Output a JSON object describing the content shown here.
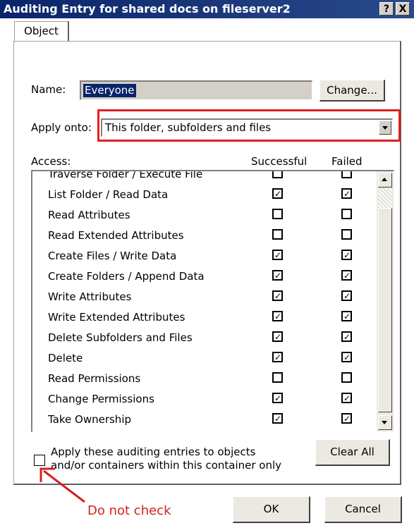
{
  "window": {
    "title": "Auditing Entry for shared docs on fileserver2",
    "help_label": "?",
    "close_label": "X"
  },
  "tab": {
    "label": "Object"
  },
  "name": {
    "label": "Name:",
    "value": "Everyone",
    "change_label": "Change..."
  },
  "apply_onto": {
    "label": "Apply onto:",
    "value": "This folder, subfolders and files"
  },
  "access": {
    "label": "Access:",
    "col_successful": "Successful",
    "col_failed": "Failed",
    "rows": [
      {
        "label": "Traverse Folder / Execute File",
        "successful": false,
        "failed": false
      },
      {
        "label": "List Folder / Read Data",
        "successful": true,
        "failed": true
      },
      {
        "label": "Read Attributes",
        "successful": false,
        "failed": false
      },
      {
        "label": "Read Extended Attributes",
        "successful": false,
        "failed": false
      },
      {
        "label": "Create Files / Write Data",
        "successful": true,
        "failed": true
      },
      {
        "label": "Create Folders / Append Data",
        "successful": true,
        "failed": true
      },
      {
        "label": "Write Attributes",
        "successful": true,
        "failed": true
      },
      {
        "label": "Write Extended Attributes",
        "successful": true,
        "failed": true
      },
      {
        "label": "Delete Subfolders and Files",
        "successful": true,
        "failed": true
      },
      {
        "label": "Delete",
        "successful": true,
        "failed": true
      },
      {
        "label": "Read Permissions",
        "successful": false,
        "failed": false
      },
      {
        "label": "Change Permissions",
        "successful": true,
        "failed": true
      },
      {
        "label": "Take Ownership",
        "successful": true,
        "failed": true
      }
    ]
  },
  "apply_within": {
    "line1": "Apply these auditing entries to objects",
    "line2": "and/or containers within this container only",
    "checked": false
  },
  "clear_all_label": "Clear All",
  "ok_label": "OK",
  "cancel_label": "Cancel",
  "annotation": {
    "text": "Do not check",
    "color": "#d62020"
  },
  "colors": {
    "titlebar": "#0a246a",
    "selection": "#0a246a",
    "highlight_box": "#e02020"
  }
}
